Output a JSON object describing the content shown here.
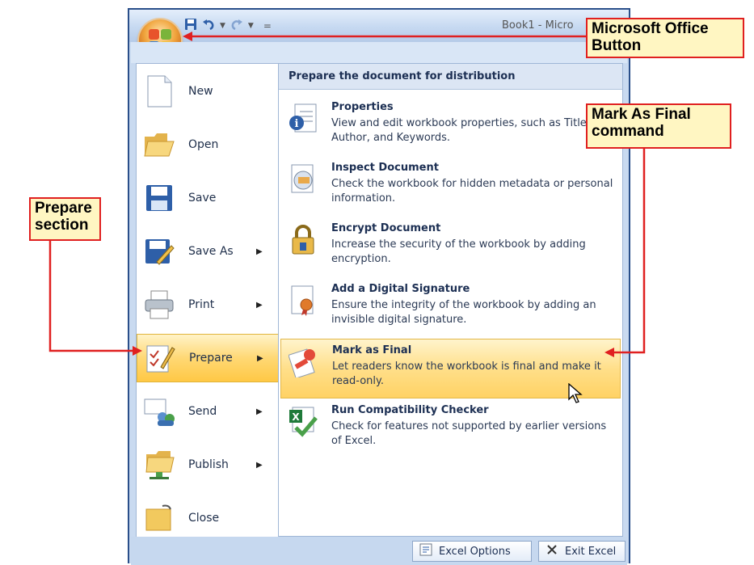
{
  "window": {
    "title": "Book1 - Micro",
    "qat_separator": "="
  },
  "left_menu": [
    {
      "label": "New",
      "has_arrow": false
    },
    {
      "label": "Open",
      "has_arrow": false
    },
    {
      "label": "Save",
      "has_arrow": false
    },
    {
      "label": "Save As",
      "has_arrow": true
    },
    {
      "label": "Print",
      "has_arrow": true
    },
    {
      "label": "Prepare",
      "has_arrow": true
    },
    {
      "label": "Send",
      "has_arrow": true
    },
    {
      "label": "Publish",
      "has_arrow": true
    },
    {
      "label": "Close",
      "has_arrow": false
    }
  ],
  "prepare_pane": {
    "header": "Prepare the document for distribution",
    "commands": [
      {
        "title": "Properties",
        "desc": "View and edit workbook properties, such as Title, Author, and Keywords."
      },
      {
        "title": "Inspect Document",
        "desc": "Check the workbook for hidden metadata or personal information."
      },
      {
        "title": "Encrypt Document",
        "desc": "Increase the security of the workbook by adding encryption."
      },
      {
        "title": "Add a Digital Signature",
        "desc": "Ensure the integrity of the workbook by adding an invisible digital signature."
      },
      {
        "title": "Mark as Final",
        "desc": "Let readers know the workbook is final and make it read-only."
      },
      {
        "title": "Run Compatibility Checker",
        "desc": "Check for features not supported by earlier versions of Excel."
      }
    ]
  },
  "bottom_buttons": {
    "options": "Excel Options",
    "exit": "Exit Excel"
  },
  "callouts": {
    "office_button": "Microsoft Office Button",
    "mark_final": "Mark As Final command",
    "prepare": "Prepare section"
  },
  "colors": {
    "callout_border": "#e02020",
    "callout_fill": "#fff6c2",
    "highlight": "#ffd874"
  }
}
